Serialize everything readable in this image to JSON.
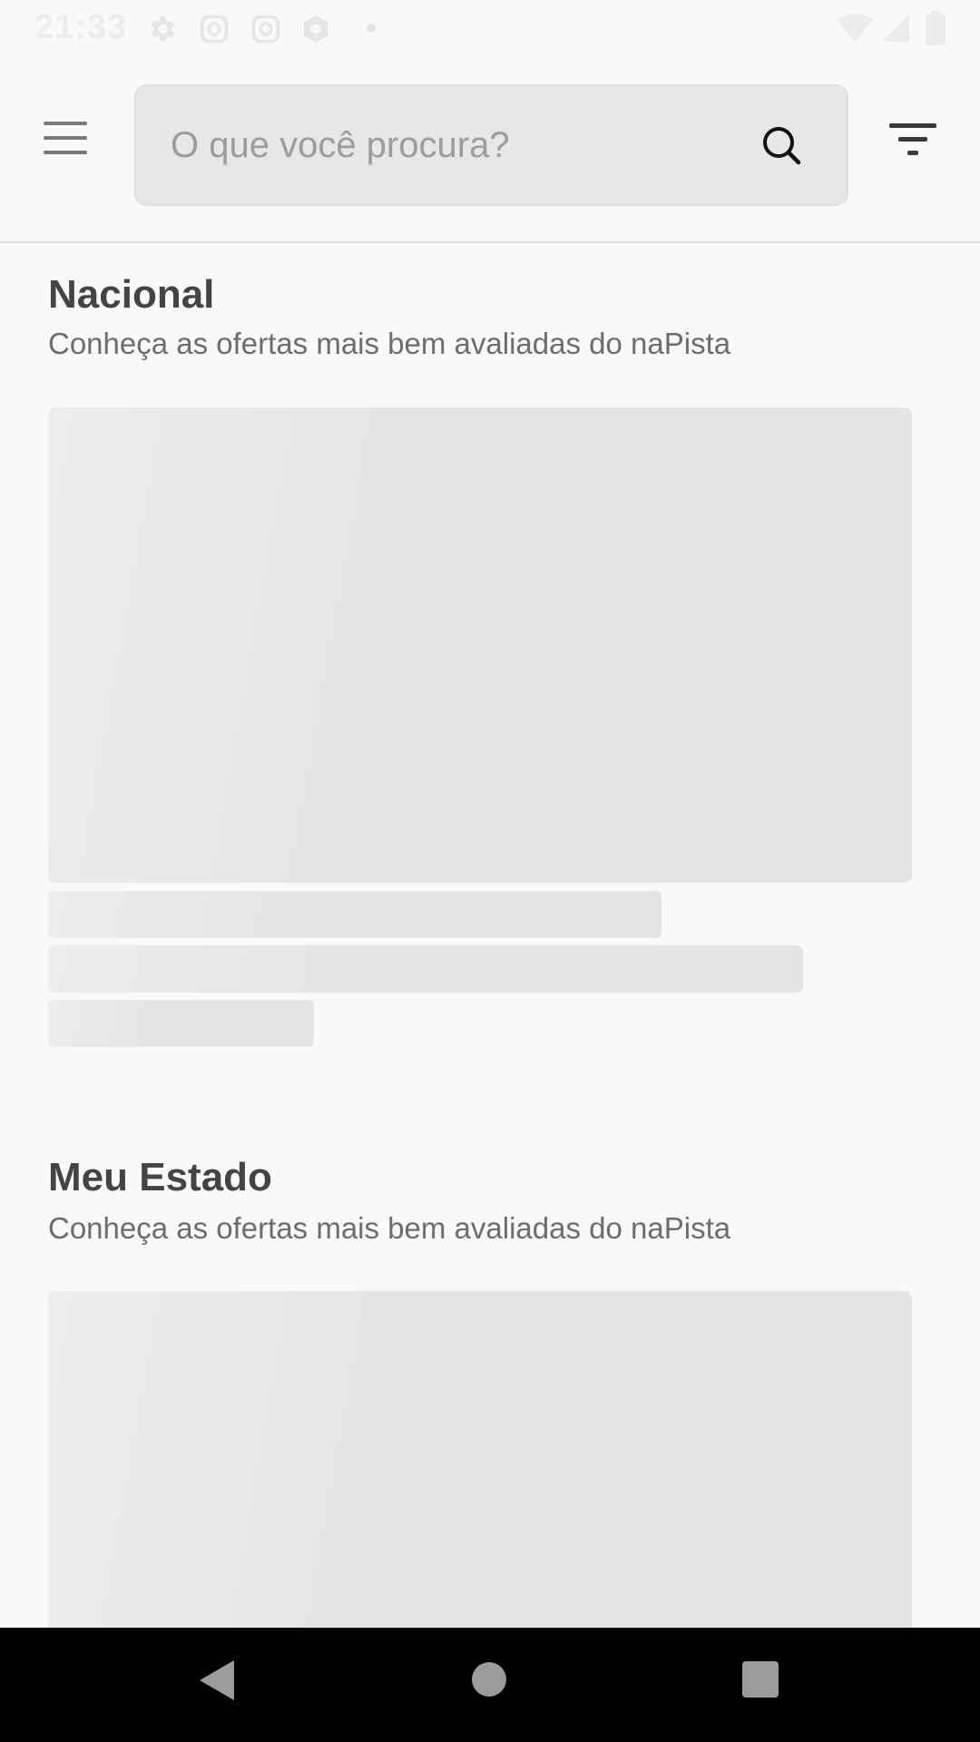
{
  "status_bar": {
    "time": "21:33",
    "icons": [
      "gear-icon",
      "instagram-icon",
      "instagram-icon",
      "app-icon",
      "notification-dot",
      "wifi-icon",
      "signal-icon",
      "battery-icon"
    ]
  },
  "header": {
    "menu_icon": "hamburger-menu-icon",
    "search_placeholder": "O que você procura?",
    "search_icon": "search-icon",
    "filter_icon": "filter-icon"
  },
  "sections": [
    {
      "title": "Nacional",
      "subtitle": "Conheça as ofertas mais bem avaliadas do naPista"
    },
    {
      "title": "Meu Estado",
      "subtitle": "Conheça as ofertas mais bem avaliadas do naPista"
    }
  ],
  "nav_bar": {
    "icons": [
      "back-icon",
      "home-icon",
      "recents-icon"
    ]
  },
  "colors": {
    "background": "#f9f9f9",
    "skeleton": "#e5e5e5",
    "title": "#444444",
    "subtitle": "#6d6d6d",
    "nav_bar": "#000000"
  }
}
